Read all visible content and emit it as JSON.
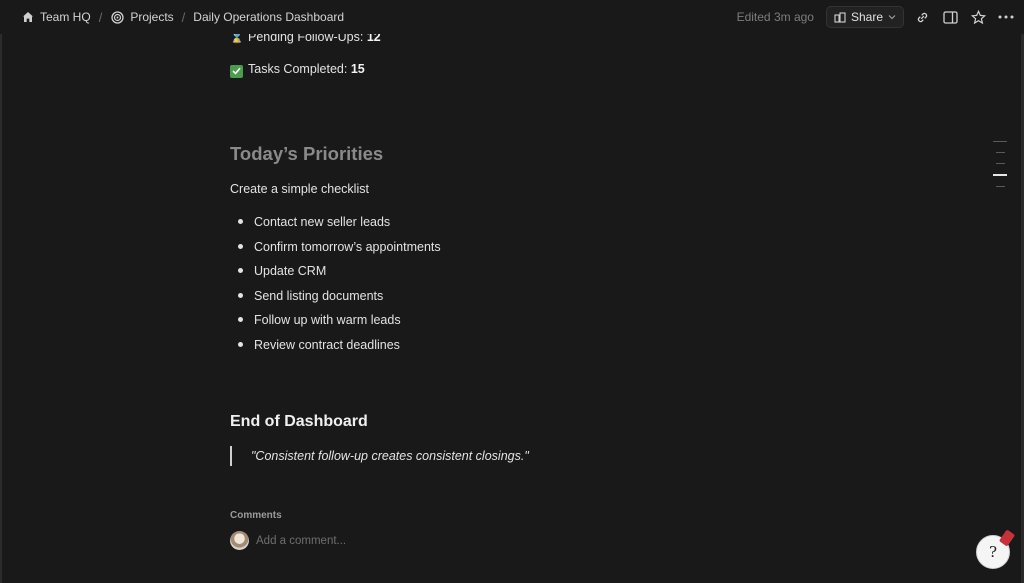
{
  "breadcrumb": {
    "items": [
      {
        "label": "Team HQ",
        "icon": "home-icon"
      },
      {
        "label": "Projects",
        "icon": "target-icon"
      },
      {
        "label": "Daily Operations Dashboard",
        "icon": ""
      }
    ],
    "separator": "/"
  },
  "header": {
    "edited": "Edited 3m ago",
    "share_label": "Share"
  },
  "stats": {
    "pending_label": "Pending Follow-Ups:",
    "pending_value": "12",
    "completed_label": "Tasks Completed:",
    "completed_value": "15"
  },
  "priorities": {
    "heading": "Today’s Priorities",
    "intro": "Create a simple checklist",
    "items": [
      "Contact new seller leads",
      "Confirm tomorrow’s appointments",
      "Update CRM",
      "Send listing documents",
      "Follow up with warm leads",
      "Review contract deadlines"
    ]
  },
  "end": {
    "heading": "End of Dashboard",
    "quote": "\"Consistent follow-up creates consistent closings.\""
  },
  "comments": {
    "label": "Comments",
    "placeholder": "Add a comment..."
  },
  "colors": {
    "background": "#191919",
    "heading_muted": "#8a8a8a",
    "check_green": "#4a9d4d"
  }
}
